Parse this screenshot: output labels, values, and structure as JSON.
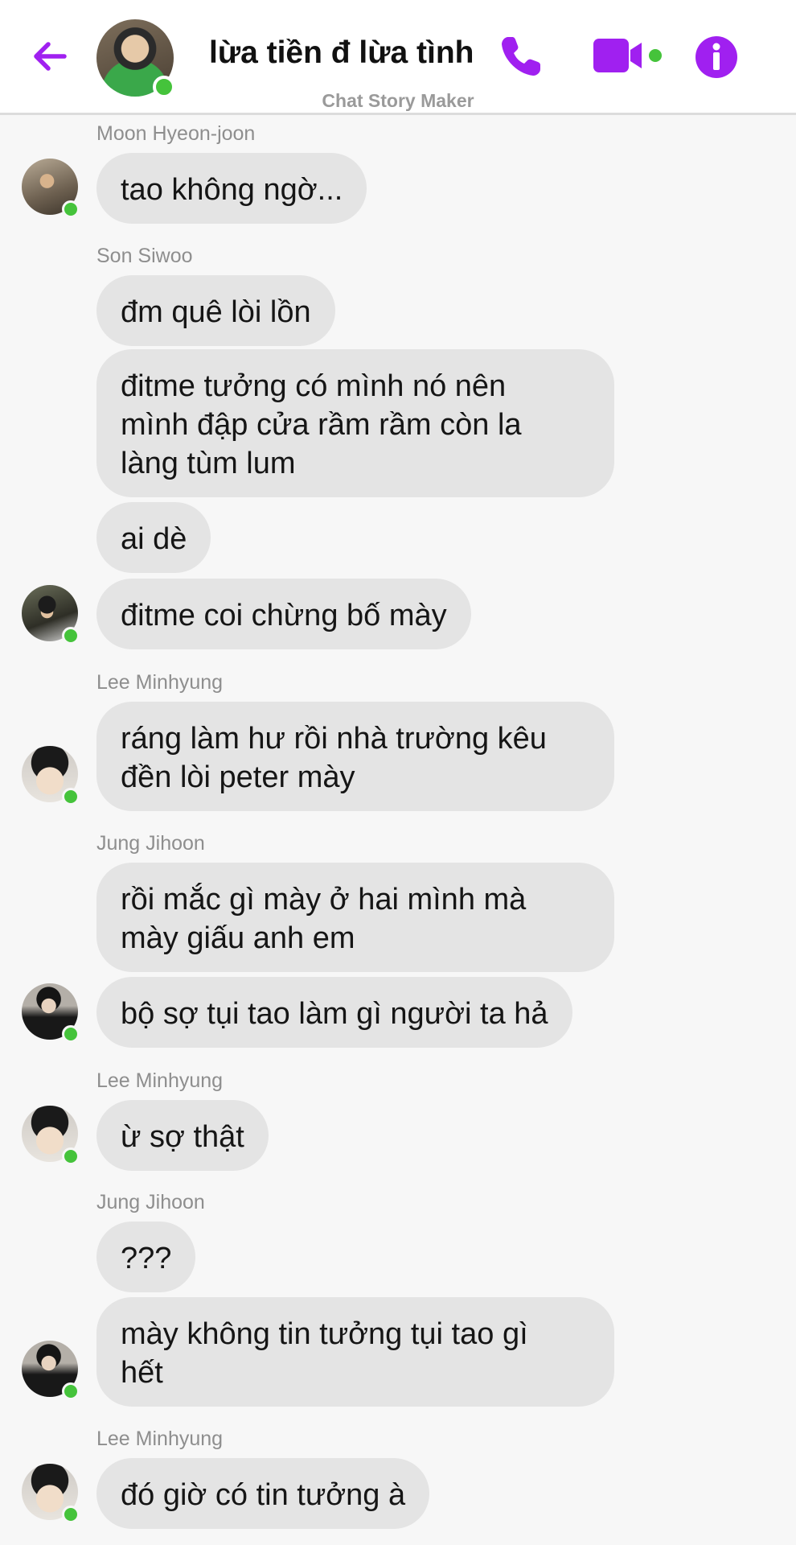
{
  "header": {
    "title": "lừa tiền đ lừa tình",
    "subtitle": "Chat Story Maker",
    "accent_color": "#a020f0",
    "online_color": "#45c33b",
    "icons": {
      "back": "arrow-left-icon",
      "phone": "phone-icon",
      "video": "video-camera-icon",
      "info": "info-icon"
    }
  },
  "messages": [
    {
      "sender": "Moon Hyeon-joon",
      "texts": [
        "tao không ngờ..."
      ]
    },
    {
      "sender": "Son Siwoo",
      "texts": [
        "đm quê lòi lồn",
        "đitme tưởng có mình nó nên\nmình đập cửa rầm rầm còn la\nlàng tùm lum",
        "ai dè",
        "đitme coi chừng bố mày"
      ]
    },
    {
      "sender": "Lee Minhyung",
      "texts": [
        "ráng làm hư rồi nhà trường kêu\nđền lòi peter mày"
      ]
    },
    {
      "sender": "Jung Jihoon",
      "texts": [
        "rồi mắc gì mày ở hai mình mà\nmày giấu anh em",
        "bộ sợ tụi tao làm gì người ta hả"
      ]
    },
    {
      "sender": "Lee Minhyung",
      "texts": [
        "ừ sợ thật"
      ]
    },
    {
      "sender": "Jung Jihoon",
      "texts": [
        "???",
        "mày không tin tưởng tụi tao gì\nhết"
      ]
    },
    {
      "sender": "Lee Minhyung",
      "texts": [
        "đó giờ có tin tưởng à"
      ]
    }
  ]
}
